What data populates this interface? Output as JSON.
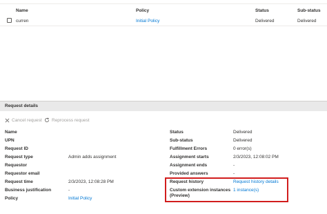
{
  "table": {
    "headers": {
      "name": "Name",
      "policy": "Policy",
      "status": "Status",
      "substatus": "Sub-status"
    },
    "rows": [
      {
        "name": "curren",
        "policy": "Initial Policy",
        "status": "Delivered",
        "substatus": "Delivered"
      }
    ]
  },
  "details": {
    "section_title": "Request details",
    "commands": {
      "cancel": "Cancel request",
      "reprocess": "Reprocess request"
    },
    "left": {
      "name": {
        "label": "Name",
        "value": ""
      },
      "upn": {
        "label": "UPN",
        "value": ""
      },
      "request_id": {
        "label": "Request ID",
        "value": ""
      },
      "request_type": {
        "label": "Request type",
        "value": "Admin adds assignment"
      },
      "requestor": {
        "label": "Requestor",
        "value": ""
      },
      "requestor_email": {
        "label": "Requestor email",
        "value": ""
      },
      "request_time": {
        "label": "Request time",
        "value": "2/3/2023, 12:08:28 PM"
      },
      "business_justification": {
        "label": "Business justification",
        "value": "-"
      },
      "policy": {
        "label": "Policy",
        "value": "Initial Policy"
      }
    },
    "right": {
      "status": {
        "label": "Status",
        "value": "Delivered"
      },
      "sub_status": {
        "label": "Sub-status",
        "value": "Delivered"
      },
      "fulfillment_errors": {
        "label": "Fulfillment Errors",
        "value": "0 error(s)"
      },
      "assignment_starts": {
        "label": "Assignment starts",
        "value": "2/3/2023, 12:08:02 PM"
      },
      "assignment_ends": {
        "label": "Assignment ends",
        "value": "-"
      },
      "provided_answers": {
        "label": "Provided answers",
        "value": "-"
      },
      "request_history": {
        "label": "Request history",
        "value": "Request history details"
      },
      "custom_extension_line1": "Custom extension instances",
      "custom_extension_line2": "(Preview)",
      "custom_extension_value": "1 instance(s)"
    }
  },
  "colors": {
    "link": "#0078d4",
    "highlight": "#d11c1c",
    "section_bar": "#e9e9e9"
  },
  "icons": {
    "cancel": "close-icon",
    "reprocess": "refresh-icon"
  }
}
